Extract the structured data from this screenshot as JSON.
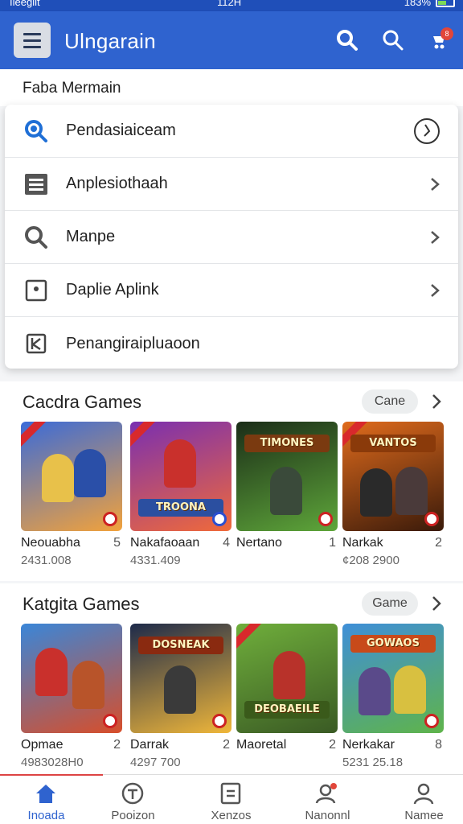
{
  "status_bar": {
    "left_text": "Ileegiit",
    "time": "112H",
    "right_text": "183%"
  },
  "app_bar": {
    "title": "Ulngarain",
    "cart_count": "8"
  },
  "page_subtitle": "Faba Mermain",
  "menu": {
    "items": [
      {
        "label": "Pendasiaiceam",
        "icon": "search-icon",
        "trailing": "clock-icon"
      },
      {
        "label": "Anplesiothaah",
        "icon": "list-icon",
        "trailing": "chevron-right-icon"
      },
      {
        "label": "Manpe",
        "icon": "search-icon",
        "trailing": "chevron-right-icon"
      },
      {
        "label": "Daplie Aplink",
        "icon": "square-dot-icon",
        "trailing": "chevron-right-icon"
      },
      {
        "label": "Penangiraipluaoon",
        "icon": "k-box-icon",
        "trailing": ""
      }
    ]
  },
  "sections": [
    {
      "title": "Cacdra Games",
      "pill": "Cane",
      "cards": [
        {
          "name": "Neouabha",
          "rank": "5",
          "meta": "2431.008",
          "logo": "",
          "bg": [
            "#3b6bd8",
            "#f2a23b"
          ]
        },
        {
          "name": "Nakafaoaan",
          "rank": "4",
          "meta": "4331.409",
          "logo": "TROONA",
          "bg": [
            "#7a2fb0",
            "#f06a3a"
          ]
        },
        {
          "name": "Nertano",
          "rank": "1",
          "meta": "",
          "logo": "TIMONES",
          "bg": [
            "#1b2d18",
            "#5ea63a"
          ]
        },
        {
          "name": "Narkak",
          "rank": "2",
          "meta": "¢208 2900",
          "logo": "VANTOS",
          "bg": [
            "#e06b1c",
            "#3a1a0a"
          ]
        }
      ]
    },
    {
      "title": "Katgita Games",
      "pill": "Game",
      "cards": [
        {
          "name": "Opmae",
          "rank": "2",
          "meta": "4983028H0",
          "logo": "",
          "bg": [
            "#3a86d8",
            "#d84e2a"
          ]
        },
        {
          "name": "Darrak",
          "rank": "2",
          "meta": "4297 700",
          "logo": "DOSNEAK",
          "bg": [
            "#1d2a4a",
            "#f0b73a"
          ]
        },
        {
          "name": "Maoretal",
          "rank": "2",
          "meta": "",
          "logo": "DEOBAEILE",
          "bg": [
            "#6fae3b",
            "#3a5a24"
          ]
        },
        {
          "name": "Nerkakar",
          "rank": "8",
          "meta": "5231 25.18",
          "logo": "GOWAOS",
          "bg": [
            "#3f8fd8",
            "#5fb44a"
          ]
        }
      ]
    }
  ],
  "bottom_nav": [
    {
      "label": "Inoada",
      "icon": "home-icon",
      "active": true
    },
    {
      "label": "Pooizon",
      "icon": "circle-t-icon",
      "active": false
    },
    {
      "label": "Xenzos",
      "icon": "box-icon",
      "active": false
    },
    {
      "label": "Nanonnl",
      "icon": "people-icon",
      "active": false
    },
    {
      "label": "Namee",
      "icon": "person-icon",
      "active": false
    }
  ],
  "colors": {
    "app_bar": "#2f63cf",
    "accent_blue": "#2f63cf",
    "badge_red": "#e2463a"
  }
}
